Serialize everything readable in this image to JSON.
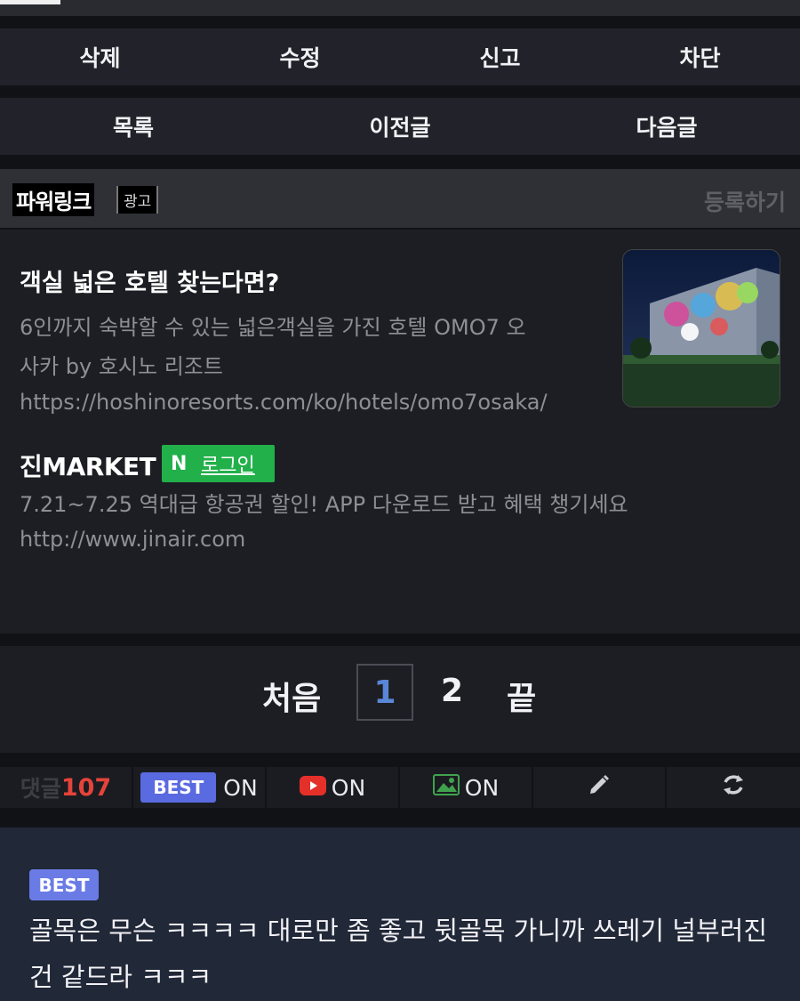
{
  "actions_row1": [
    "삭제",
    "수정",
    "신고",
    "차단"
  ],
  "actions_row2": [
    "목록",
    "이전글",
    "다음글"
  ],
  "powerlink": {
    "title": "파워링크",
    "ad_badge": "광고",
    "register": "등록하기"
  },
  "ads": [
    {
      "title": "객실 넓은 호텔 찾는다면?",
      "desc_line1": "6인까지 숙박할 수 있는 넓은객실을 가진 호텔 OMO7 오",
      "desc_line2": "사카 by 호시노 리조트",
      "url": "https://hoshinoresorts.com/ko/hotels/omo7osaka/"
    },
    {
      "title": "진MARKET",
      "login_badge": "로그인",
      "login_icon": "N",
      "desc": "7.21~7.25 역대급 항공권 할인! APP 다운로드 받고 혜택 챙기세요",
      "url": "http://www.jinair.com"
    }
  ],
  "pagination": {
    "first": "처음",
    "current": "1",
    "next_page": "2",
    "last": "끝"
  },
  "toolbar": {
    "comments_label": "댓글",
    "comments_count": "107",
    "best_label": "BEST",
    "best_state": "ON",
    "youtube_state": "ON",
    "image_state": "ON",
    "icons": [
      "youtube-icon",
      "image-icon",
      "pencil-icon",
      "refresh-icon"
    ]
  },
  "best_comment": {
    "tag": "BEST",
    "text": "골목은 무슨 ㅋㅋㅋㅋ 대로만 좀 좋고 뒷골목 가니까 쓰레기 널부러진건 같드라 ㅋㅋㅋ"
  },
  "colors": {
    "background": "#111216",
    "button_bg": "#22232a",
    "accent_blue": "#5a86d6",
    "best_purple": "#6a7be6",
    "naver_green": "#22b04b",
    "youtube_red": "#e5302a",
    "comment_count_red": "#e5433a"
  }
}
